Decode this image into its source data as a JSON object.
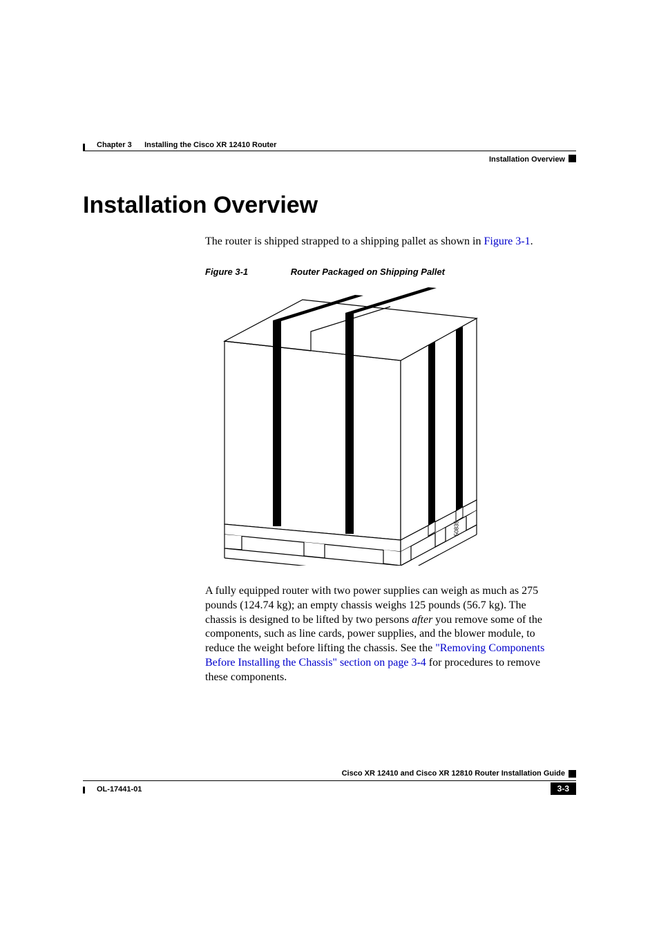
{
  "header": {
    "chapter_label": "Chapter 3",
    "chapter_title": "Installing the Cisco XR 12410 Router",
    "section_name": "Installation Overview"
  },
  "content": {
    "main_heading": "Installation Overview",
    "intro_text_part1": "The router is shipped strapped to a shipping pallet as shown in ",
    "intro_link": "Figure 3-1",
    "intro_text_part2": ".",
    "figure": {
      "number": "Figure 3-1",
      "title": "Router Packaged on Shipping Pallet",
      "drawing_id": "50835"
    },
    "body_part1": "A fully equipped router with two power supplies can weigh as much as 275 pounds (124.74 kg); an empty chassis weighs 125 pounds (56.7 kg). The chassis is designed to be lifted by two persons ",
    "body_italic": "after",
    "body_part2": " you remove some of the components, such as line cards, power supplies, and the blower module, to reduce the weight before lifting the chassis. See the ",
    "body_link": "\"Removing Components Before Installing the Chassis\" section on page 3-4",
    "body_part3": " for procedures to remove these components."
  },
  "footer": {
    "guide_title": "Cisco XR 12410 and Cisco XR 12810 Router Installation Guide",
    "page_number": "3-3",
    "doc_number": "OL-17441-01"
  }
}
